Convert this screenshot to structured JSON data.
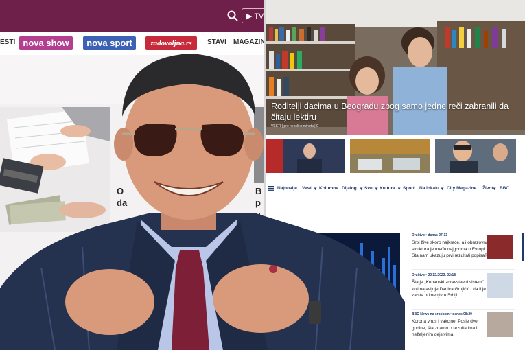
{
  "left_site": {
    "tv_button": "TV",
    "nav_left_text": "ESTI",
    "logos": {
      "novashow": "nova show",
      "novasport": "nova sport",
      "zadovoljna": "zadovoljna.rs"
    },
    "nav_stavi": "STAVI",
    "nav_magazin": "MAGAZIN",
    "snippet_1": "O\nda",
    "snippet_2": "B\np\nu"
  },
  "right_site": {
    "hero_headline": "Roditelji dacima u Beogradu zbog samo jedne reči zabranili da čitaju lektiru",
    "hero_meta": "VESTI | pre nekoliko minuta | 0",
    "nav_items": [
      "Najnovije",
      "Vesti",
      "Kolumne",
      "Dijalog",
      "Svet",
      "Kultura",
      "Sport",
      "Na lokalu",
      "City Magazine",
      "Život",
      "BBC"
    ],
    "news": [
      {
        "meta": "Društvo • danas 07:13",
        "title": "Srbi žive skoro najkraće, a i obrazovna struktura je među najgorima u Evropi: Šta nam ukazuju prvi rezultati popisa?"
      },
      {
        "meta": "Društvo • 22.12.2022. 22:18",
        "title": "Šta je „Kubanski zdravstveni sistem\" koji najavljuje Danica Grujičić i da li je zaista primenjiv u Srbiji"
      },
      {
        "meta": "BBC News na srpskom • danas 08:20",
        "title": "Korona virus i vakcine: Posle dve godine, šta znamo o rezultatima i neželjenim dejstvima"
      }
    ]
  },
  "colors": {
    "nova_top": "#6e1f4a",
    "novashow": "#b43e8f",
    "novasport": "#3c62b5",
    "zadovoljna": "#c62a3b",
    "danas_navy": "#1f3a6a"
  },
  "icons": [
    "search-icon",
    "play-icon",
    "hamburger-icon",
    "chevron-down-icon"
  ]
}
